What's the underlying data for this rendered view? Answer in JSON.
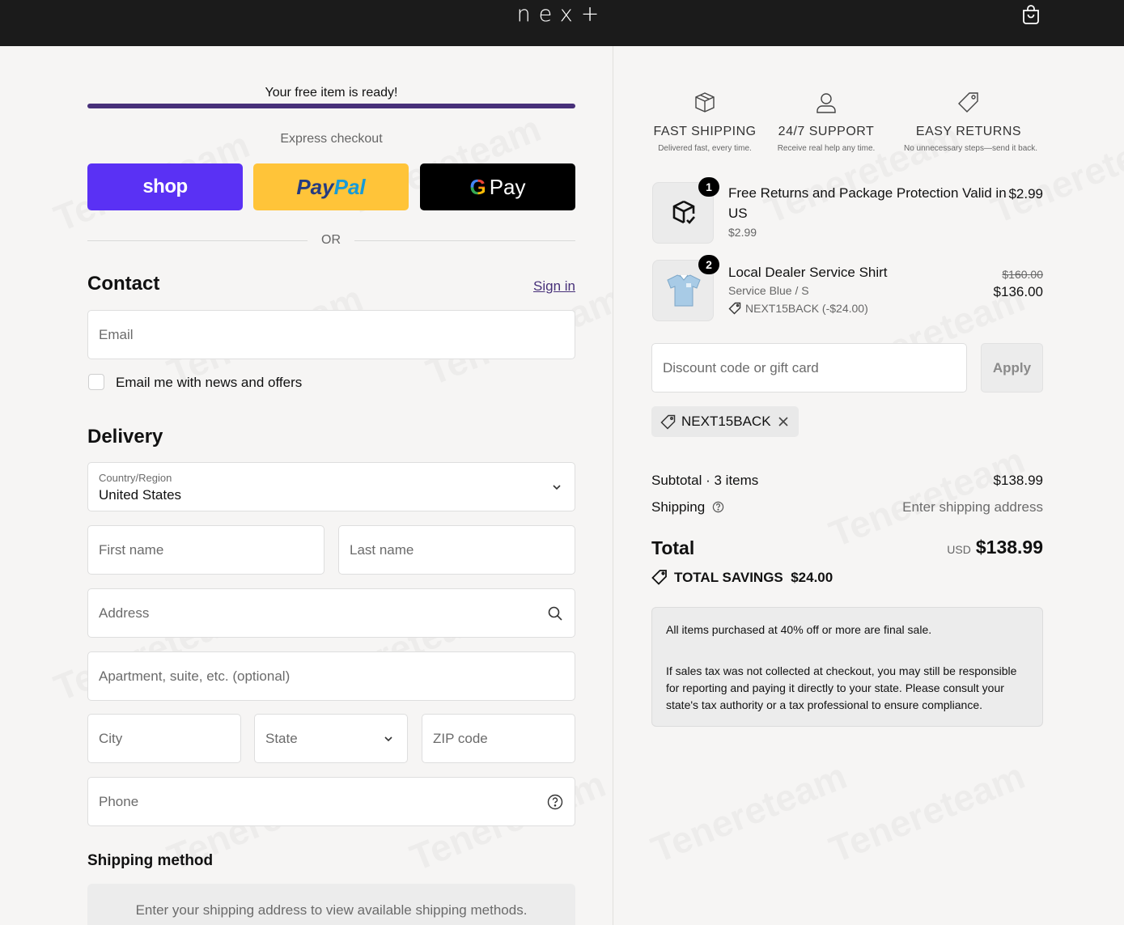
{
  "header": {
    "brand": "nex+",
    "cart_icon": "shopping-bag-icon"
  },
  "promo": {
    "text": "Your free item is ready!",
    "progress": 1.0,
    "bar_color": "#473079"
  },
  "express": {
    "label": "Express checkout",
    "shop_label": "shop",
    "paypal_label_a": "Pay",
    "paypal_label_b": "Pal",
    "gpay_g": "G",
    "gpay_label": "Pay",
    "or_label": "OR"
  },
  "contact": {
    "title": "Contact",
    "signin_label": "Sign in",
    "email_placeholder": "Email",
    "newsletter_label": "Email me with news and offers"
  },
  "delivery": {
    "title": "Delivery",
    "country_label": "Country/Region",
    "country_value": "United States",
    "first_name_placeholder": "First name",
    "last_name_placeholder": "Last name",
    "address_placeholder": "Address",
    "apartment_placeholder": "Apartment, suite, etc. (optional)",
    "city_placeholder": "City",
    "state_placeholder": "State",
    "zip_placeholder": "ZIP code",
    "phone_placeholder": "Phone"
  },
  "shipping_method": {
    "title": "Shipping method",
    "message": "Enter your shipping address to view available shipping methods."
  },
  "features": [
    {
      "icon": "box-icon",
      "title": "FAST SHIPPING",
      "subtitle": "Delivered fast, every time."
    },
    {
      "icon": "user-icon",
      "title": "24/7 SUPPORT",
      "subtitle": "Receive real help any time."
    },
    {
      "icon": "tag-icon",
      "title": "EASY RETURNS",
      "subtitle": "No unnecessary steps—send it back."
    }
  ],
  "items": [
    {
      "quantity": "1",
      "title_line1": "Free Returns and Package Protection Valid in",
      "title_line2": "US",
      "sub_price": "$2.99",
      "price": "$2.99"
    },
    {
      "quantity": "2",
      "title": "Local Dealer Service Shirt",
      "variant": "Service Blue / S",
      "discount": "NEXT15BACK (-$24.00)",
      "original_price": "$160.00",
      "price": "$136.00"
    }
  ],
  "discount": {
    "placeholder": "Discount code or gift card",
    "apply_label": "Apply",
    "applied_code": "NEXT15BACK"
  },
  "summary": {
    "subtotal_label": "Subtotal · 3 items",
    "subtotal_value": "$138.99",
    "shipping_label": "Shipping",
    "shipping_value": "Enter shipping address",
    "total_label": "Total",
    "currency": "USD",
    "total_value": "$138.99",
    "savings_label": "TOTAL SAVINGS",
    "savings_value": "$24.00"
  },
  "notice": {
    "line1": "All items purchased at 40% off or more are final sale.",
    "line2": "If sales tax was not collected at checkout, you may still be responsible for reporting and paying it directly to your state. Please consult your state's tax authority or a tax professional to ensure compliance."
  },
  "watermark": "Tenereteam"
}
